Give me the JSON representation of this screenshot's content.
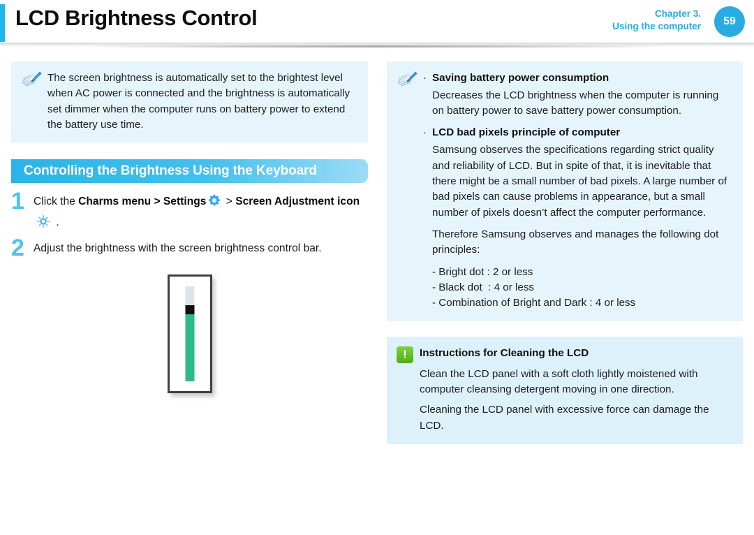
{
  "header": {
    "title": "LCD Brightness Control",
    "chapter_line1": "Chapter 3.",
    "chapter_line2": "Using the computer",
    "page_number": "59",
    "accent_color": "#20b6ef",
    "page_circle_color": "#29abe2"
  },
  "left_column": {
    "note": {
      "icon": "note-pen-icon",
      "text": "The screen brightness is automatically set to the brightest level when AC power is connected and the brightness is automatically set dimmer when the computer runs on battery power to extend the battery use time."
    },
    "section_header": {
      "title": "Controlling the Brightness Using the Keyboard",
      "gradient_from": "#2bb3e8",
      "gradient_to": "#9bdcf6"
    },
    "steps": [
      {
        "number": "1",
        "part1": "Click the ",
        "bold1": "Charms menu > Settings",
        "icon1": "gear-icon",
        "part2": " > ",
        "bold2": "Screen Adjustment icon",
        "icon2": "brightness-sun-icon",
        "part3": " ."
      },
      {
        "number": "2",
        "text": "Adjust the brightness with the screen brightness control bar."
      }
    ],
    "figure": {
      "name": "brightness-control-bar",
      "fill_color": "#2dba8a",
      "thumb_color": "#111111",
      "track_color": "#dfe6ea"
    }
  },
  "right_column": {
    "note": {
      "icon": "note-pen-icon",
      "bullets": [
        {
          "title": "Saving battery power consumption",
          "body": "Decreases the LCD brightness when the computer is running on battery power to save battery power consumption."
        },
        {
          "title": "LCD bad pixels principle of computer",
          "body": "Samsung observes the specifications regarding strict quality and reliability of LCD. But in spite of that, it is inevitable that there might be a small number of bad pixels. A large number of bad pixels can cause problems in appearance, but a small number of pixels doesn’t affect the computer performance."
        }
      ],
      "closing_para": "Therefore Samsung observes and manages the following dot principles:",
      "dot_principles": "- Bright dot : 2 or less\n- Black dot  : 4 or less\n- Combination of Bright and Dark : 4 or less"
    },
    "caution": {
      "icon": "exclamation-icon",
      "icon_glyph": "!",
      "icon_color": "#4caf16",
      "title": "Instructions for Cleaning the LCD",
      "para1": "Clean the LCD panel with a soft cloth lightly moistened with computer cleansing detergent moving in one direction.",
      "para2": "Cleaning the LCD panel with excessive force can damage the LCD."
    }
  }
}
